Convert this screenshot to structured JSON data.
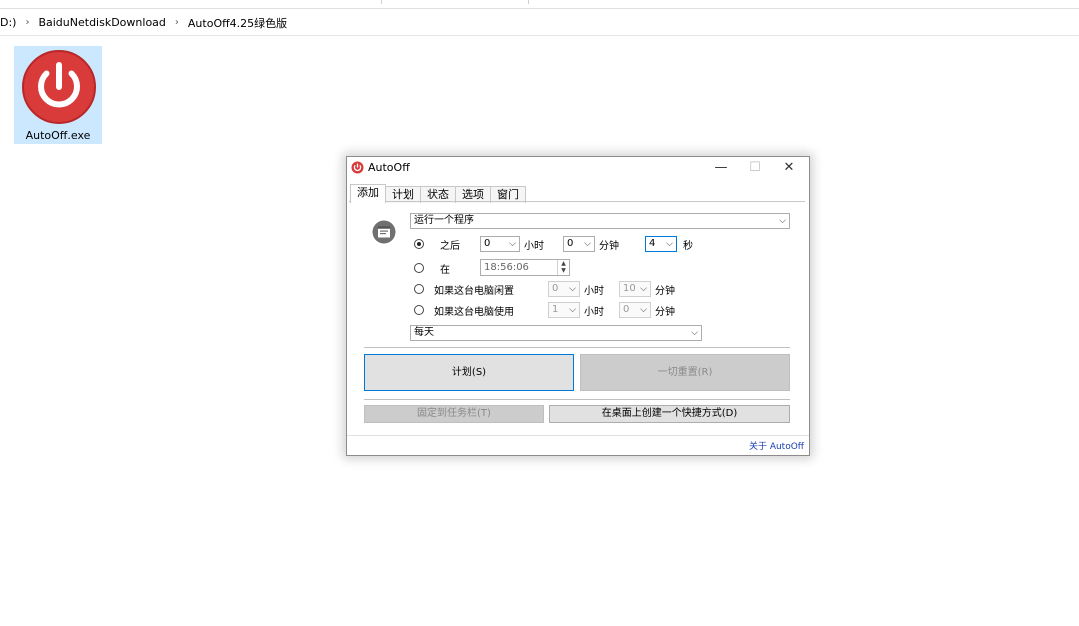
{
  "explorer": {
    "breadcrumb": [
      "D:)",
      "BaiduNetdiskDownload",
      "AutoOff4.25绿色版"
    ]
  },
  "file": {
    "name": "AutoOff.exe",
    "icon": "power-icon",
    "icon_color": "#d93a3a"
  },
  "dialog": {
    "title": "AutoOff",
    "controls": {
      "minimize": "—",
      "maximize": "☐",
      "close": "✕"
    },
    "tabs": [
      {
        "label": "添加",
        "active": true
      },
      {
        "label": "计划",
        "active": false
      },
      {
        "label": "状态",
        "active": false
      },
      {
        "label": "选项",
        "active": false
      },
      {
        "label": "窗门",
        "active": false
      }
    ],
    "action_select": "运行一个程序",
    "options": {
      "after": {
        "label": "之后",
        "hours": "0",
        "hours_unit": "小时",
        "minutes": "0",
        "minutes_unit": "分钟",
        "seconds": "4",
        "seconds_unit": "秒",
        "checked": true
      },
      "at": {
        "label": "在",
        "time": "18:56:06",
        "checked": false
      },
      "idle": {
        "label": "如果这台电脑闲置",
        "hours": "0",
        "hours_unit": "小时",
        "minutes": "10",
        "minutes_unit": "分钟",
        "checked": false
      },
      "using": {
        "label": "如果这台电脑使用",
        "hours": "1",
        "hours_unit": "小时",
        "minutes": "0",
        "minutes_unit": "分钟",
        "checked": false
      }
    },
    "repeat_select": "每天",
    "buttons": {
      "plan": "计划(S)",
      "reset_all": "一切重置(R)",
      "pin_taskbar": "固定到任务栏(T)",
      "desktop_shortcut": "在桌面上创建一个快捷方式(D)"
    },
    "about": "关于 AutoOff"
  },
  "colors": {
    "accent": "#0078d7",
    "selection": "#cce8ff",
    "icon_red": "#d93a3a"
  }
}
